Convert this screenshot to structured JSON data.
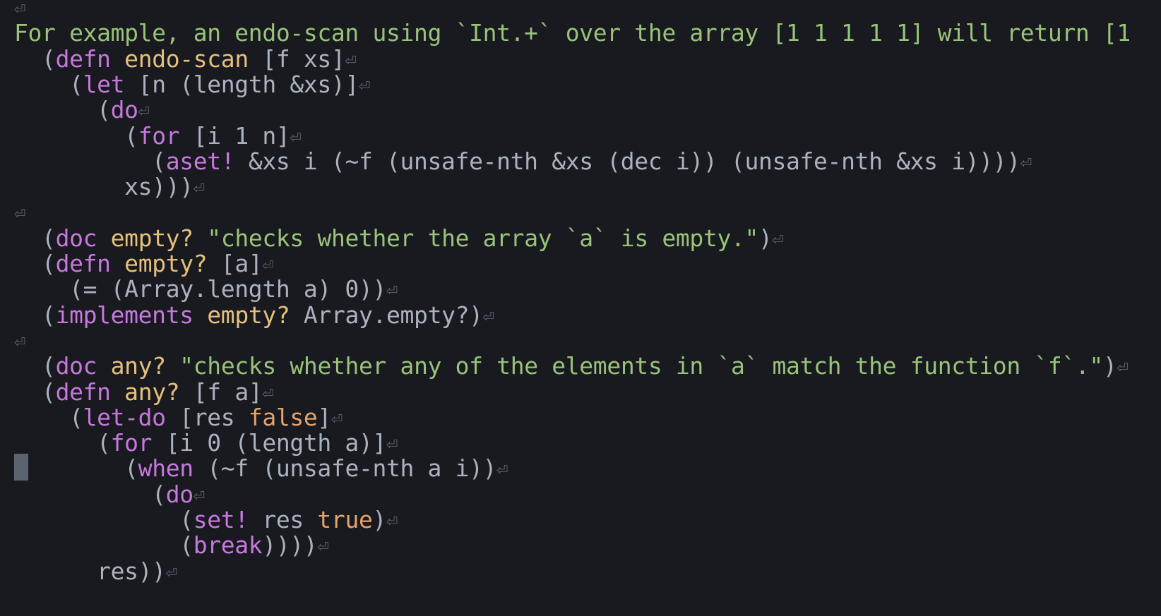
{
  "editor": {
    "eol_marker": "⏎",
    "colors": {
      "background": "#181a1f",
      "default_text": "#abb2bf",
      "keyword": "#c678dd",
      "definition_name": "#e5c07b",
      "string": "#98c379",
      "constant": "#e5a36b",
      "eol_marker": "#5c6370",
      "cursor": "#5c6370"
    },
    "lines": [
      {
        "eol": true,
        "tokens": []
      },
      {
        "eol": false,
        "tokens": [
          {
            "t": "For example, an endo-scan using `Int.+` over the array [1 1 1 1 1] will return [1",
            "c": "comment"
          }
        ]
      },
      {
        "eol": true,
        "tokens": [
          {
            "t": "  (",
            "c": "default"
          },
          {
            "t": "defn",
            "c": "keyword"
          },
          {
            "t": " ",
            "c": "default"
          },
          {
            "t": "endo-scan",
            "c": "def"
          },
          {
            "t": " [f xs]",
            "c": "default"
          }
        ]
      },
      {
        "eol": true,
        "tokens": [
          {
            "t": "    (",
            "c": "default"
          },
          {
            "t": "let",
            "c": "keyword"
          },
          {
            "t": " [n (length &xs)]",
            "c": "default"
          }
        ]
      },
      {
        "eol": true,
        "tokens": [
          {
            "t": "      (",
            "c": "default"
          },
          {
            "t": "do",
            "c": "keyword"
          }
        ]
      },
      {
        "eol": true,
        "tokens": [
          {
            "t": "        (",
            "c": "default"
          },
          {
            "t": "for",
            "c": "keyword"
          },
          {
            "t": " [i 1 n]",
            "c": "default"
          }
        ]
      },
      {
        "eol": true,
        "tokens": [
          {
            "t": "          (",
            "c": "default"
          },
          {
            "t": "aset!",
            "c": "keyword"
          },
          {
            "t": " &xs i (~f (unsafe-nth &xs (dec i)) (unsafe-nth &xs i))))",
            "c": "default"
          }
        ]
      },
      {
        "eol": true,
        "tokens": [
          {
            "t": "        xs)))",
            "c": "default"
          }
        ]
      },
      {
        "eol": true,
        "tokens": []
      },
      {
        "eol": true,
        "tokens": [
          {
            "t": "  (",
            "c": "default"
          },
          {
            "t": "doc",
            "c": "keyword"
          },
          {
            "t": " ",
            "c": "default"
          },
          {
            "t": "empty?",
            "c": "def"
          },
          {
            "t": " ",
            "c": "default"
          },
          {
            "t": "\"checks whether the array `a` is empty.\"",
            "c": "string"
          },
          {
            "t": ")",
            "c": "default"
          }
        ]
      },
      {
        "eol": true,
        "tokens": [
          {
            "t": "  (",
            "c": "default"
          },
          {
            "t": "defn",
            "c": "keyword"
          },
          {
            "t": " ",
            "c": "default"
          },
          {
            "t": "empty?",
            "c": "def"
          },
          {
            "t": " [a]",
            "c": "default"
          }
        ]
      },
      {
        "eol": true,
        "tokens": [
          {
            "t": "    (= (Array.length a) 0))",
            "c": "default"
          }
        ]
      },
      {
        "eol": true,
        "tokens": [
          {
            "t": "  (",
            "c": "default"
          },
          {
            "t": "implements",
            "c": "keyword"
          },
          {
            "t": " ",
            "c": "default"
          },
          {
            "t": "empty?",
            "c": "def"
          },
          {
            "t": " Array.empty?)",
            "c": "default"
          }
        ]
      },
      {
        "eol": true,
        "tokens": []
      },
      {
        "eol": true,
        "tokens": [
          {
            "t": "  (",
            "c": "default"
          },
          {
            "t": "doc",
            "c": "keyword"
          },
          {
            "t": " ",
            "c": "default"
          },
          {
            "t": "any?",
            "c": "def"
          },
          {
            "t": " ",
            "c": "default"
          },
          {
            "t": "\"checks whether any of the elements in `a` match the function `f`.\"",
            "c": "string"
          },
          {
            "t": ")",
            "c": "default"
          }
        ]
      },
      {
        "eol": true,
        "tokens": [
          {
            "t": "  (",
            "c": "default"
          },
          {
            "t": "defn",
            "c": "keyword"
          },
          {
            "t": " ",
            "c": "default"
          },
          {
            "t": "any?",
            "c": "def"
          },
          {
            "t": " [f a]",
            "c": "default"
          }
        ]
      },
      {
        "eol": true,
        "tokens": [
          {
            "t": "    (",
            "c": "default"
          },
          {
            "t": "let-do",
            "c": "keyword"
          },
          {
            "t": " [res ",
            "c": "default"
          },
          {
            "t": "false",
            "c": "const"
          },
          {
            "t": "]",
            "c": "default"
          }
        ]
      },
      {
        "eol": true,
        "tokens": [
          {
            "t": "      (",
            "c": "default"
          },
          {
            "t": "for",
            "c": "keyword"
          },
          {
            "t": " [i 0 (length a)]",
            "c": "default"
          }
        ]
      },
      {
        "eol": true,
        "tokens": [
          {
            "t": "        (",
            "c": "default"
          },
          {
            "t": "when",
            "c": "keyword"
          },
          {
            "t": " (~f (unsafe-nth a i))",
            "c": "default"
          }
        ]
      },
      {
        "eol": true,
        "tokens": [
          {
            "t": "          (",
            "c": "default"
          },
          {
            "t": "do",
            "c": "keyword"
          }
        ]
      },
      {
        "eol": true,
        "tokens": [
          {
            "t": "            (",
            "c": "default"
          },
          {
            "t": "set!",
            "c": "keyword"
          },
          {
            "t": " res ",
            "c": "default"
          },
          {
            "t": "true",
            "c": "const"
          },
          {
            "t": ")",
            "c": "default"
          }
        ]
      },
      {
        "eol": true,
        "tokens": [
          {
            "t": "            (",
            "c": "default"
          },
          {
            "t": "break",
            "c": "keyword"
          },
          {
            "t": "))))",
            "c": "default"
          }
        ]
      },
      {
        "eol": true,
        "tokens": [
          {
            "t": "      res))",
            "c": "default"
          }
        ]
      }
    ]
  }
}
